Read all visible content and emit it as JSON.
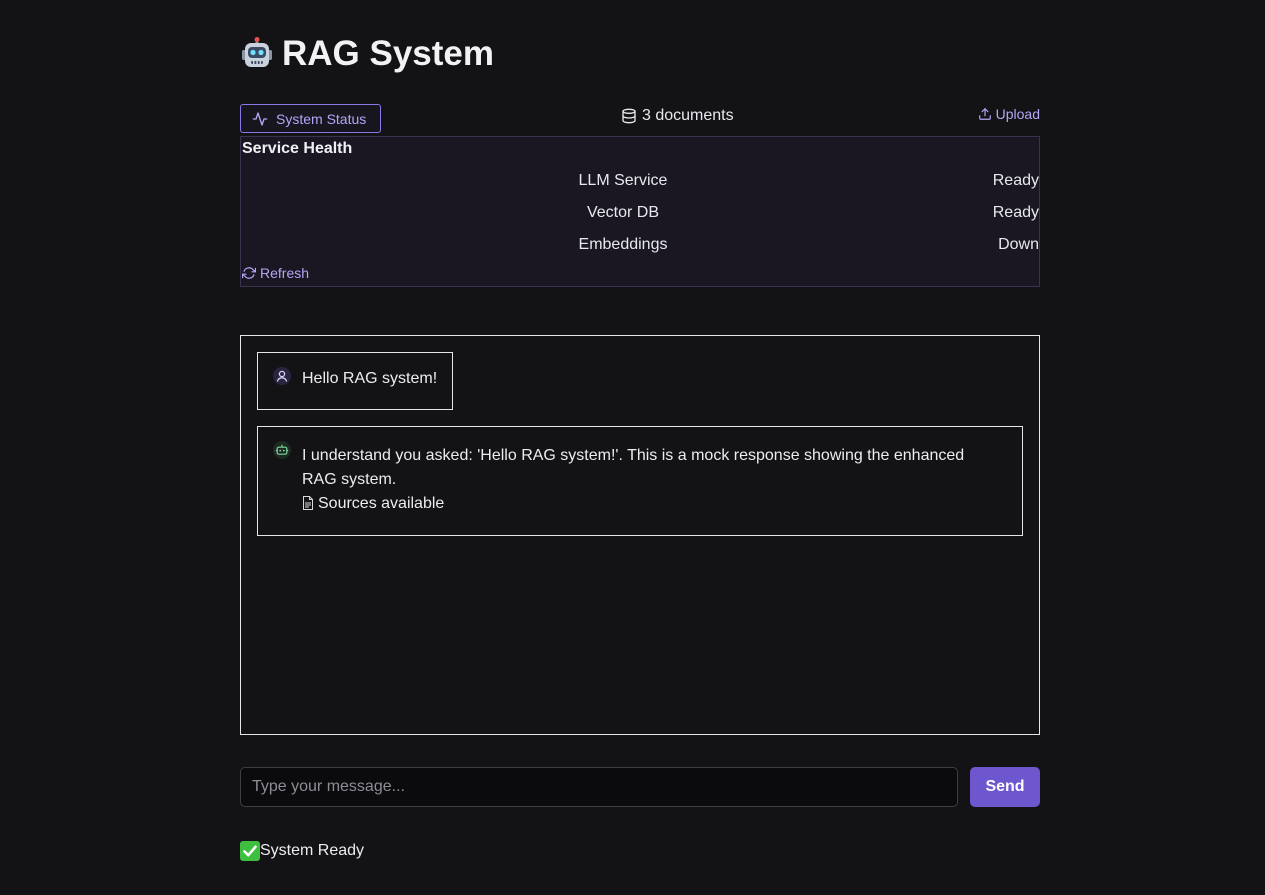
{
  "header": {
    "title": "RAG System",
    "title_icon": "robot-emoji"
  },
  "toolbar": {
    "status_button_label": "System Status",
    "status_icon": "activity-icon",
    "document_count": "3 documents",
    "document_icon": "database-icon",
    "upload_label": "Upload",
    "upload_icon": "upload-icon"
  },
  "health": {
    "title": "Service Health",
    "services": [
      {
        "name": "LLM Service",
        "state": "Ready"
      },
      {
        "name": "Vector DB",
        "state": "Ready"
      },
      {
        "name": "Embeddings",
        "state": "Down"
      }
    ],
    "refresh_label": "Refresh",
    "refresh_icon": "refresh-icon"
  },
  "chat": {
    "messages": [
      {
        "role": "user",
        "icon": "user-icon",
        "text": "Hello RAG system!"
      },
      {
        "role": "assistant",
        "icon": "bot-icon",
        "text": "I understand you asked: 'Hello RAG system!'. This is a mock response showing the enhanced RAG system.",
        "sources_label": "Sources available",
        "sources_icon": "file-icon"
      }
    ]
  },
  "composer": {
    "placeholder": "Type your message...",
    "value": "",
    "send_label": "Send"
  },
  "footer": {
    "status_text": "System Ready",
    "status_icon": "check-icon"
  },
  "colors": {
    "background": "#131316",
    "accent": "#6e56cf",
    "accent_text": "#b4a6f5",
    "panel_bg": "#1a1722",
    "success": "#3fbf3f"
  }
}
